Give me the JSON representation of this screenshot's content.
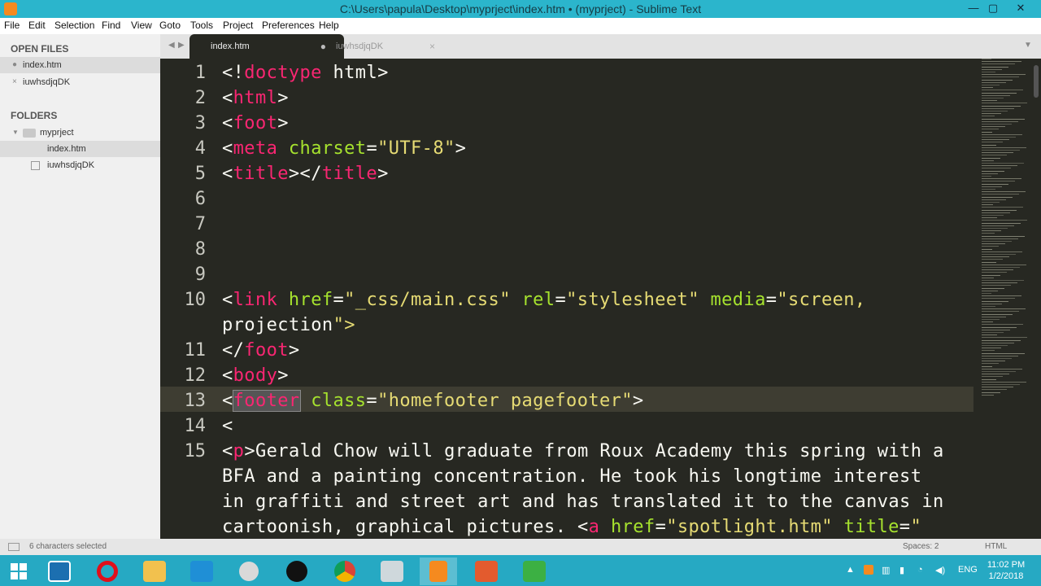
{
  "window": {
    "title": "C:\\Users\\papula\\Desktop\\myprject\\index.htm • (myprject) - Sublime Text"
  },
  "menu": [
    "File",
    "Edit",
    "Selection",
    "Find",
    "View",
    "Goto",
    "Tools",
    "Project",
    "Preferences",
    "Help"
  ],
  "sidebar": {
    "open_files_header": "OPEN FILES",
    "open_files": [
      {
        "label": "index.htm",
        "marker": "●"
      },
      {
        "label": "iuwhsdjqDK",
        "marker": "×"
      }
    ],
    "folders_header": "FOLDERS",
    "folder": {
      "label": "myprject",
      "arrow": "▼"
    },
    "files": [
      {
        "label": "index.htm"
      },
      {
        "label": "iuwhsdjqDK"
      }
    ]
  },
  "tabs": [
    {
      "label": "index.htm",
      "mark": "●"
    },
    {
      "label": "iuwhsdjqDK",
      "mark": "×"
    }
  ],
  "editor": {
    "lines": [
      {
        "n": "1",
        "text": "<!doctype html>"
      },
      {
        "n": "2",
        "text": "<html>"
      },
      {
        "n": "3",
        "text": "<foot>"
      },
      {
        "n": "4",
        "text": "<meta charset=\"UTF-8\">"
      },
      {
        "n": "5",
        "text": "<title></title>"
      },
      {
        "n": "6",
        "text": ""
      },
      {
        "n": "7",
        "text": ""
      },
      {
        "n": "8",
        "text": ""
      },
      {
        "n": "9",
        "text": ""
      },
      {
        "n": "10",
        "text": "<link href=\"_css/main.css\" rel=\"stylesheet\" media=\"screen,"
      },
      {
        "n": "",
        "text": "projection\">"
      },
      {
        "n": "11",
        "text": "</foot>"
      },
      {
        "n": "12",
        "text": "<body>"
      },
      {
        "n": "13",
        "text": "<footer class=\"homefooter pagefooter\">"
      },
      {
        "n": "14",
        "text": "<"
      },
      {
        "n": "15",
        "text": "<p>Gerald Chow will graduate from Roux Academy this spring with a"
      },
      {
        "n": "",
        "text": "BFA and a painting concentration. He took his longtime interest"
      },
      {
        "n": "",
        "text": "in graffiti and street art and has translated it to the canvas in"
      },
      {
        "n": "",
        "text": "cartoonish, graphical pictures. <a href=\"spotlight.htm\" title=\""
      }
    ],
    "highlighted_line": "13"
  },
  "status": {
    "selection": "6 characters selected",
    "spaces": "Spaces: 2",
    "syntax": "HTML"
  },
  "taskbar": {
    "time": "11:02 PM",
    "date": "1/2/2018",
    "lang": "ENG"
  },
  "colors": {
    "titlebar": "#2bb5cc",
    "editor_bg": "#272822",
    "tag": "#f92672",
    "attr": "#a6e22e",
    "string": "#e6db74",
    "taskbar": "#26a9c3"
  }
}
